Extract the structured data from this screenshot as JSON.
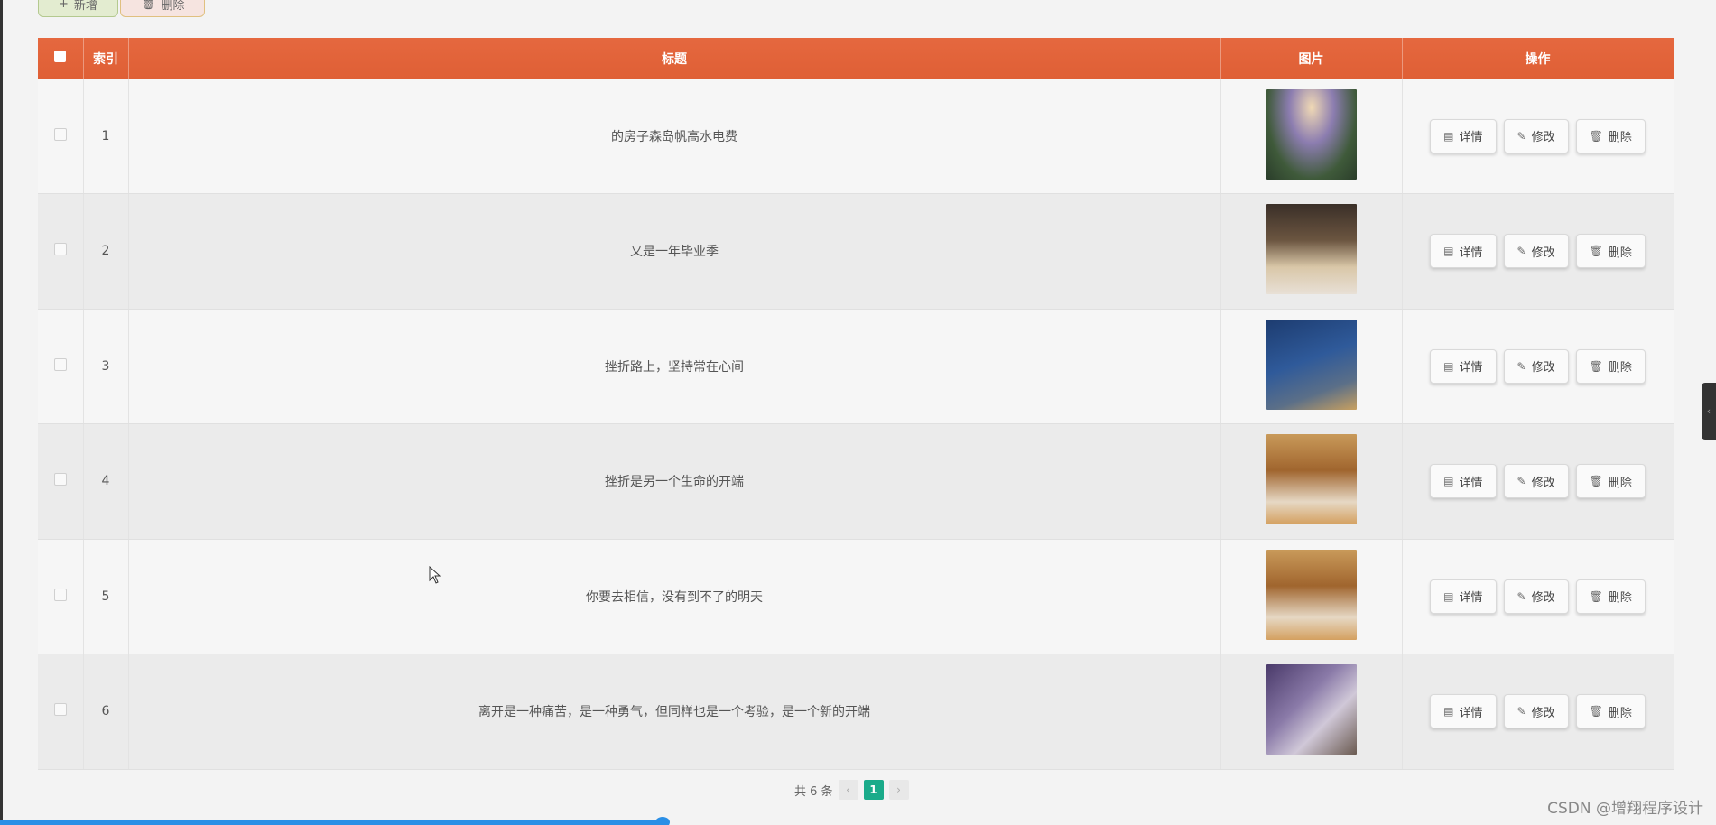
{
  "toolbar": {
    "add_label": "新增",
    "delete_label": "删除"
  },
  "table": {
    "headers": {
      "index": "索引",
      "title": "标题",
      "image": "图片",
      "actions": "操作"
    },
    "actions": {
      "detail": "详情",
      "edit": "修改",
      "delete": "删除"
    },
    "rows": [
      {
        "index": "1",
        "title": "的房子森岛帆高水电费",
        "image": "misty-forest-photo"
      },
      {
        "index": "2",
        "title": "又是一年毕业季",
        "image": "hotel-room-twin-beds-photo"
      },
      {
        "index": "3",
        "title": "挫折路上，坚持常在心间",
        "image": "hotel-tower-night-photo"
      },
      {
        "index": "4",
        "title": "挫折是另一个生命的开端",
        "image": "hotel-room-warm-photo"
      },
      {
        "index": "5",
        "title": "你要去相信，没有到不了的明天",
        "image": "hotel-room-warm-photo"
      },
      {
        "index": "6",
        "title": "离开是一种痛苦，是一种勇气，但同样也是一个考验，是一个新的开端",
        "image": "suite-purple-photo"
      }
    ]
  },
  "pagination": {
    "total_label": "共 6 条",
    "current_page": "1",
    "prev_icon": "chevron-left-icon",
    "next_icon": "chevron-right-icon"
  },
  "watermark": "CSDN @增翔程序设计",
  "colors": {
    "header_bg": "#e5683f",
    "page_active": "#1aab8a",
    "progress": "#2a8fe6"
  }
}
